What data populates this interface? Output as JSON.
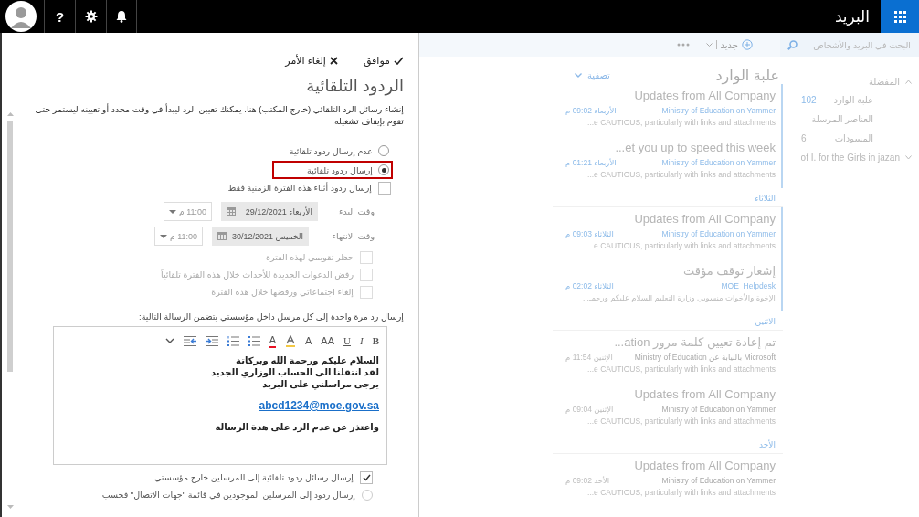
{
  "top_bar": {
    "help": "?",
    "app_title": "البريد"
  },
  "toolbar": {
    "search": {
      "placeholder": "البحث في البريد والأشخاص"
    },
    "new_label": "جديد"
  },
  "folders": {
    "favorites": {
      "label": "المفضلة",
      "expanded": true
    },
    "items": [
      {
        "name": "علبة الوارد",
        "count": "102"
      },
      {
        "name": "العناصر المرسلة"
      },
      {
        "name": "المسودات",
        "count": "6"
      }
    ],
    "group": {
      "label": "of I. for the Girls in jazan",
      "expanded": false
    }
  },
  "inbox": {
    "title": "علبة الوارد",
    "filter": "تصفية",
    "items": [
      {
        "kind": "message",
        "subject": "Updates from All Company",
        "sender": "Ministry of Education on Yammer",
        "time": "الأربعاء 09:02 م",
        "preview": "e CAUTIOUS, particularly with links and attachments...",
        "unread": true
      },
      {
        "kind": "message",
        "subject": "et you up to speed this week...",
        "sender": "Ministry of Education on Yammer",
        "time": "الأربعاء 01:21 م",
        "preview": "e CAUTIOUS, particularly with links and attachments...",
        "unread": true
      },
      {
        "kind": "day",
        "label": "الثلاثاء"
      },
      {
        "kind": "message",
        "subject": "Updates from All Company",
        "sender": "Ministry of Education on Yammer",
        "time": "الثلاثاء 09:03 م",
        "preview": "e CAUTIOUS, particularly with links and attachments...",
        "unread": true
      },
      {
        "kind": "message",
        "subject": "إشعار توقف مؤقت",
        "sender": "MOE_Helpdesk",
        "time": "الثلاثاء 02:02 م",
        "preview": "الإخوة والأخوات منسوبي وزارة التعليم السلام عليكم ورحمـ...",
        "unread": true
      },
      {
        "kind": "day",
        "label": "الاثنين"
      },
      {
        "kind": "message",
        "subject": "تم إعادة تعيين كلمة مرور ation...",
        "sender": "Microsoft بالنيابة عن Ministry of Education",
        "time": "الإثنين 11:54 م",
        "preview": "e CAUTIOUS, particularly with links and attachments...",
        "unread": false
      },
      {
        "kind": "message",
        "subject": "Updates from All Company",
        "sender": "Ministry of Education on Yammer",
        "time": "الإثنين 09:04 م",
        "preview": "e CAUTIOUS, particularly with links and attachments...",
        "unread": false
      },
      {
        "kind": "day",
        "label": "الأحد"
      },
      {
        "kind": "message",
        "subject": "Updates from All Company",
        "sender": "Ministry of Education on Yammer",
        "time": "الأحد 09:02 م",
        "preview": "e CAUTIOUS, particularly with links and attachments...",
        "unread": false
      }
    ]
  },
  "auto_reply": {
    "ok": "موافق",
    "cancel": "إلغاء الأمر",
    "title": "الردود التلقائية",
    "description": "إنشاء رسائل الرد التلقائي (خارج المكتب) هنا. يمكنك تعيين الرد ليبدأ في وقت محدد أو تعيينه ليستمر حتى تقوم بإيقاف تشغيله.",
    "modes": [
      {
        "label": "عدم إرسال ردود تلقائية",
        "selected": false,
        "highlighted": false
      },
      {
        "label": "إرسال ردود تلقائية",
        "selected": true,
        "highlighted": true
      }
    ],
    "period_only": {
      "label": "إرسال ردود أثناء هذه الفترة الزمنية فقط",
      "checked": false
    },
    "times": [
      {
        "label": "وقت البدء",
        "date": "الأربعاء 29/12/2021",
        "time": "11:00 م"
      },
      {
        "label": "وقت الانتهاء",
        "date": "الخميس 30/12/2021",
        "time": "11:00 م"
      }
    ],
    "period_options": [
      {
        "label": "حظر تقويمي لهذه الفترة",
        "checked": false,
        "disabled": true
      },
      {
        "label": "رفض الدعوات الجديدة للأحداث خلال هذه الفترة تلقائياً",
        "checked": false,
        "disabled": true
      },
      {
        "label": "إلغاء اجتماعاتي ورفضها خلال هذه الفترة",
        "checked": false,
        "disabled": true
      }
    ],
    "inside_label": "إرسال رد مرة واحدة إلى كل مرسل داخل مؤسستي يتضمن الرسالة التالية:",
    "editor": {
      "tools": [
        {
          "kind": "bold",
          "glyph": "B"
        },
        {
          "kind": "italic",
          "glyph": "I"
        },
        {
          "kind": "underline",
          "glyph": "U"
        },
        {
          "kind": "font-size",
          "glyph": "AA"
        },
        {
          "kind": "grow",
          "glyph": "A"
        },
        {
          "kind": "highlight"
        },
        {
          "kind": "font-color",
          "glyph": "A"
        },
        {
          "kind": "bullets"
        },
        {
          "kind": "numbering"
        },
        {
          "kind": "indent"
        },
        {
          "kind": "outdent"
        },
        {
          "kind": "more"
        }
      ],
      "lines": [
        "السلام عليكم ورحمة الله وبركاتة",
        "لقد انتقلنا الى الحساب الوزاري الجديد",
        "يرجى مراسلتي على البريد"
      ],
      "email": "abcd1234@moe.gov.sa",
      "closing": "واعتذر عن عدم الرد على هذة الرسالة"
    },
    "outside": {
      "label": "إرسال رسائل ردود تلقائية إلى المرسلين خارج مؤسستي",
      "checked": true
    },
    "contacts_only": {
      "label": "إرسال ردود إلى المرسلين الموجودين في قائمة \"جهات الاتصال\" فحسب",
      "selected": false
    }
  }
}
